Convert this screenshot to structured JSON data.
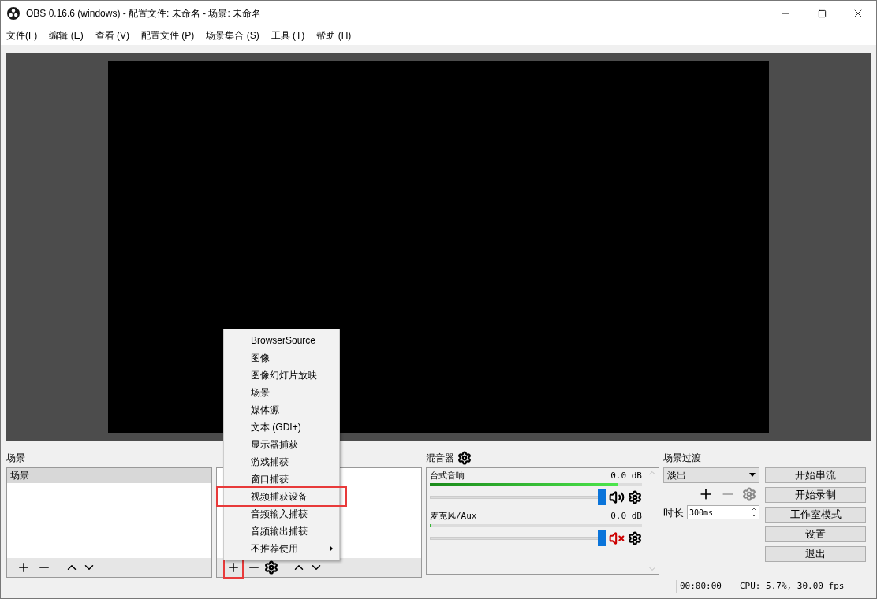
{
  "window": {
    "title": "OBS 0.16.6 (windows) - 配置文件: 未命名 - 场景: 未命名"
  },
  "menu_bar": [
    "文件(F)",
    "编辑 (E)",
    "查看 (V)",
    "配置文件 (P)",
    "场景集合 (S)",
    "工具 (T)",
    "帮助 (H)"
  ],
  "scenes": {
    "title": "场景",
    "items": [
      {
        "label": "场景",
        "selected": true
      }
    ]
  },
  "sources": {
    "add_highlighted": true
  },
  "add_source_menu": [
    {
      "label": "BrowserSource",
      "highlighted": false,
      "submenu": false
    },
    {
      "label": "图像",
      "highlighted": false,
      "submenu": false
    },
    {
      "label": "图像幻灯片放映",
      "highlighted": false,
      "submenu": false
    },
    {
      "label": "场景",
      "highlighted": false,
      "submenu": false
    },
    {
      "label": "媒体源",
      "highlighted": false,
      "submenu": false
    },
    {
      "label": "文本 (GDI+)",
      "highlighted": false,
      "submenu": false
    },
    {
      "label": "显示器捕获",
      "highlighted": false,
      "submenu": false
    },
    {
      "label": "游戏捕获",
      "highlighted": false,
      "submenu": false
    },
    {
      "label": "窗口捕获",
      "highlighted": false,
      "submenu": false
    },
    {
      "label": "视频捕获设备",
      "highlighted": true,
      "submenu": false
    },
    {
      "label": "音频输入捕获",
      "highlighted": false,
      "submenu": false
    },
    {
      "label": "音频输出捕获",
      "highlighted": false,
      "submenu": false
    },
    {
      "label": "不推荐使用",
      "highlighted": false,
      "submenu": true
    }
  ],
  "mixer": {
    "title": "混音器",
    "channels": [
      {
        "name": "台式音响",
        "reading": "0.0 dB",
        "meter": {
          "level": 0.89
        },
        "volume": {
          "level": 1
        },
        "muted": false
      },
      {
        "name": "麦克风/Aux",
        "reading": "0.0 dB",
        "meter": {
          "level": 0.0
        },
        "volume": {
          "level": 1
        },
        "muted": true
      }
    ]
  },
  "transitions": {
    "title": "场景过渡",
    "transition": "淡出",
    "duration_label": "时长",
    "duration": "300ms"
  },
  "controls": [
    "开始串流",
    "开始录制",
    "工作室模式",
    "设置",
    "退出"
  ],
  "status_bar": {
    "time": "00:00:00",
    "stats": "CPU: 5.7%, 30.00 fps"
  }
}
